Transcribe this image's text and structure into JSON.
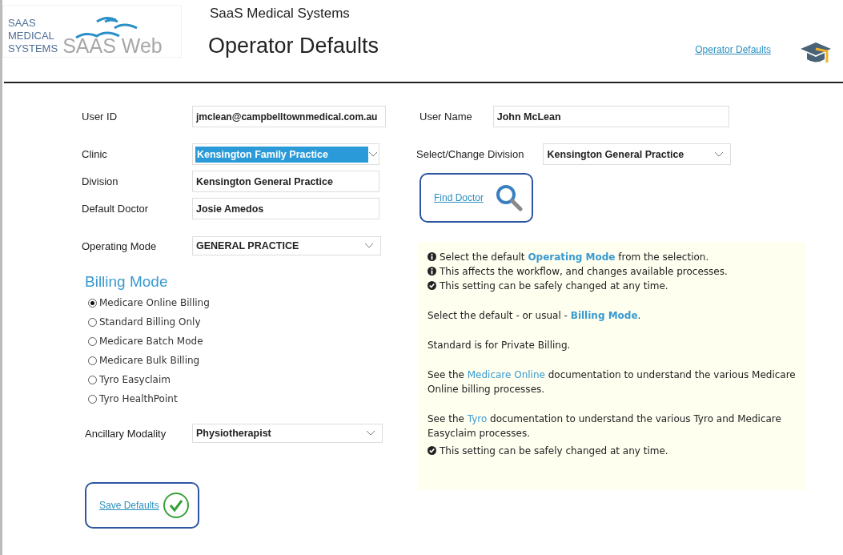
{
  "logo": {
    "lines": [
      "SAAS",
      "MEDICAL",
      "SYSTEMS"
    ],
    "wordmark": "SAAS Web"
  },
  "header": {
    "company": "SaaS Medical Systems",
    "title": "Operator Defaults",
    "link": "Operator Defaults"
  },
  "left_fields": [
    {
      "label": "User ID",
      "kind": "text",
      "value": "jmclean@campbelltownmedical.com.au",
      "highlighted": false
    },
    {
      "label": "Clinic",
      "kind": "select",
      "value": "Kensington Family Practice",
      "highlighted": true
    },
    {
      "label": "Division",
      "kind": "text",
      "value": "Kensington General Practice",
      "highlighted": false
    },
    {
      "label": "Default Doctor",
      "kind": "text",
      "value": "Josie Amedos",
      "highlighted": false
    },
    {
      "label": "Operating Mode",
      "kind": "select",
      "value": "GENERAL PRACTICE",
      "highlighted": false
    }
  ],
  "billing": {
    "title": "Billing Mode",
    "options": [
      {
        "label": "Medicare Online Billing",
        "selected": true
      },
      {
        "label": "Standard Billing Only",
        "selected": false
      },
      {
        "label": "Medicare Batch Mode",
        "selected": false
      },
      {
        "label": "Medicare Bulk Billing",
        "selected": false
      },
      {
        "label": "Tyro Easyclaim",
        "selected": false
      },
      {
        "label": "Tyro HealthPoint",
        "selected": false
      }
    ]
  },
  "ancillary": {
    "label": "Ancillary Modality",
    "kind": "select",
    "value": "Physiotherapist"
  },
  "save_button": "Save Defaults",
  "right_fields": [
    {
      "label": "User Name",
      "kind": "text",
      "value": "John McLean"
    },
    {
      "label": "Select/Change Division",
      "kind": "select",
      "value": "Kensington General Practice"
    }
  ],
  "find_button": "Find Doctor",
  "help": [
    {
      "kind": "info",
      "parts": [
        {
          "kind": "plain",
          "text": "Select the default "
        },
        {
          "kind": "term",
          "text": "Operating Mode"
        },
        {
          "kind": "plain",
          "text": " from the selection."
        }
      ]
    },
    {
      "kind": "info",
      "parts": [
        {
          "kind": "plain",
          "text": "This affects the workflow, and changes available processes."
        }
      ]
    },
    {
      "kind": "check",
      "parts": [
        {
          "kind": "plain",
          "text": "This setting can be safely changed at any time."
        }
      ]
    },
    {
      "kind": "text",
      "parts": [
        {
          "kind": "plain",
          "text": "Select the default - or usual - "
        },
        {
          "kind": "term",
          "text": "Billing Mode"
        },
        {
          "kind": "plain",
          "text": "."
        }
      ]
    },
    {
      "kind": "text",
      "parts": [
        {
          "kind": "plain",
          "text": "Standard is for Private Billing."
        }
      ]
    },
    {
      "kind": "text",
      "parts": [
        {
          "kind": "plain",
          "text": "See the "
        },
        {
          "kind": "link",
          "text": "Medicare Online"
        },
        {
          "kind": "plain",
          "text": " documentation to understand the various Medicare Online billing processes."
        }
      ]
    },
    {
      "kind": "text",
      "parts": [
        {
          "kind": "plain",
          "text": "See the "
        },
        {
          "kind": "link",
          "text": "Tyro"
        },
        {
          "kind": "plain",
          "text": " documentation to understand the various Tyro and Medicare Easyclaim processes."
        }
      ]
    },
    {
      "kind": "check",
      "parts": [
        {
          "kind": "plain",
          "text": "This setting can be safely changed at any time."
        }
      ]
    }
  ]
}
